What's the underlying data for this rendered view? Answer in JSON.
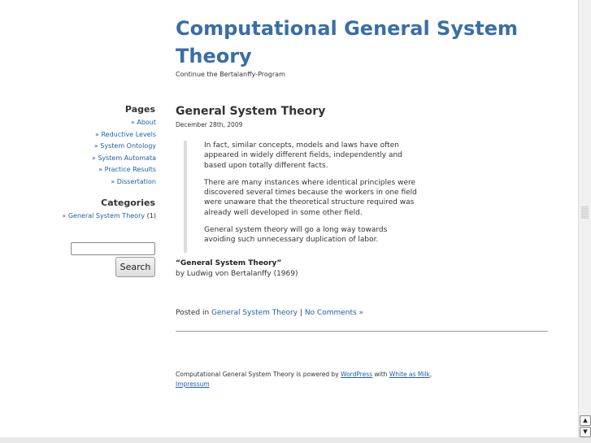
{
  "site": {
    "title": "Computational General System Theory",
    "tagline": "Continue the Bertalanffy-Program"
  },
  "sidebar": {
    "pages_heading": "Pages",
    "pages": [
      "» About",
      "» Reductive Levels",
      "» System Ontology",
      "» System Automata",
      "» Practice Results",
      "» Dissertation"
    ],
    "categories_heading": "Categories",
    "category": {
      "prefix": "» ",
      "label": "General System Theory",
      "count": "(1)"
    },
    "search": {
      "value": "",
      "button_label": "Search"
    }
  },
  "post": {
    "title": "General System Theory",
    "date": "December 28th, 2009",
    "quote_paragraphs": [
      "In fact, similar concepts, models and laws have often appeared in widely different fields, independently and based upon totally different facts.",
      "There are many instances where identical principles were discovered several times because the workers in one field were unaware that the theoretical structure required was already well developed in some other field.",
      "General system theory will go a long way towards avoiding such unnecessary duplication of labor."
    ],
    "attribution_title": "“General System Theory”",
    "attribution_author": "by Ludwig von Bertalanffy (1969)",
    "meta": {
      "posted_in": "Posted in ",
      "category_link": "General System Theory",
      "separator": " | ",
      "comments_link": "No Comments »"
    }
  },
  "footer": {
    "text_before": "Computational General System Theory is powered by ",
    "wordpress_link": "WordPress",
    "text_with": " with ",
    "theme_link": "White as Milk",
    "comma": ",",
    "impressum_link": "Impressum"
  },
  "scrollbar": {
    "up_icon": "▲",
    "down_icon": "▼"
  }
}
